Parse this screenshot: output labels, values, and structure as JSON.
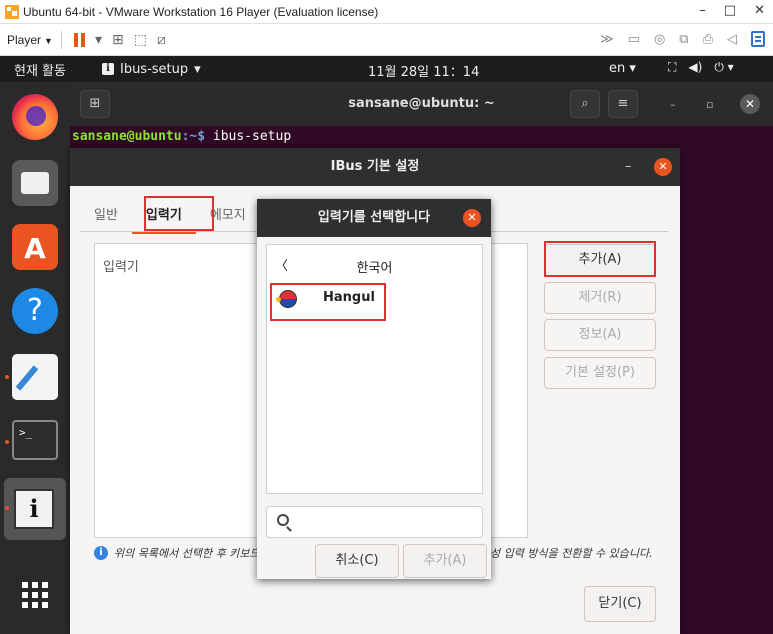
{
  "vmware": {
    "title": "Ubuntu 64-bit - VMware Workstation 16 Player (Evaluation license)",
    "player_label": "Player",
    "window_buttons": [
      "–",
      "□",
      "✕"
    ]
  },
  "topbar": {
    "activities": "현재 활동",
    "app_name": "Ibus-setup",
    "clock": "11월 28일  11：14",
    "lang": "en ▾"
  },
  "terminal": {
    "title": "sansane@ubuntu: ~",
    "prompt_user": "sansane@ubuntu",
    "prompt_path": ":~$",
    "command": " ibus-setup"
  },
  "ibus": {
    "title": "IBus 기본 설정",
    "tabs": [
      "일반",
      "입력기",
      "에모지"
    ],
    "list_header": "입력기",
    "buttons": {
      "add": "추가(A)",
      "remove": "제거(R)",
      "info": "정보(A)",
      "prefs": "기본 설정(P)",
      "close": "닫기(C)"
    },
    "hint_left": "위의 목록에서 선택한 후 키보드",
    "hint_right": "성 입력 방식을 전환할 수 있습니다."
  },
  "chooser": {
    "title": "입력기를 선택합니다",
    "back_label": "한국어",
    "item": "Hangul",
    "search_placeholder": "",
    "cancel": "취소(C)",
    "add": "추가(A)"
  },
  "colors": {
    "ubuntu_orange": "#e95420",
    "terminal_bg": "#300a24",
    "highlight_red": "#e03030"
  }
}
